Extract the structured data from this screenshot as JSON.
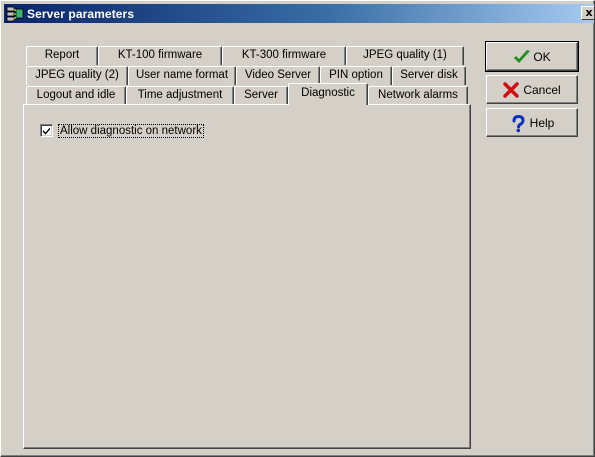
{
  "window": {
    "title": "Server parameters",
    "close_glyph": "x"
  },
  "tabs": {
    "row1": [
      "Report",
      "KT-100 firmware",
      "KT-300 firmware",
      "JPEG quality (1)"
    ],
    "row2": [
      "JPEG quality (2)",
      "User name format",
      "Video Server",
      "PIN option",
      "Server disk"
    ],
    "row3": [
      "Logout and idle",
      "Time adjustment",
      "Server",
      "Diagnostic",
      "Network alarms"
    ],
    "selected": "Diagnostic"
  },
  "panel": {
    "checkbox_label": "Allow diagnostic on network",
    "checkbox_checked": true
  },
  "buttons": {
    "ok": "OK",
    "cancel": "Cancel",
    "help": "Help"
  },
  "icons": {
    "app": "server-parameters-icon",
    "ok": "checkmark-icon",
    "cancel": "red-x-icon",
    "help": "question-mark-icon"
  },
  "colors": {
    "title_start": "#0a246a",
    "title_end": "#a6caf0",
    "face": "#d4d0c8",
    "ok_green": "#1e8f1e",
    "cancel_red": "#d01010",
    "help_blue": "#1030c0"
  }
}
